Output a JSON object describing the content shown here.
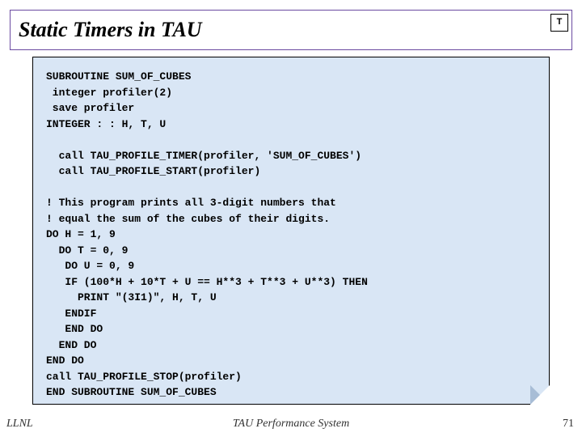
{
  "title": "Static Timers in TAU",
  "logo": "T",
  "code_lines": [
    "SUBROUTINE SUM_OF_CUBES",
    " integer profiler(2)",
    " save profiler",
    "INTEGER : : H, T, U",
    "",
    "  call TAU_PROFILE_TIMER(profiler, 'SUM_OF_CUBES')",
    "  call TAU_PROFILE_START(profiler)",
    "",
    "! This program prints all 3-digit numbers that",
    "! equal the sum of the cubes of their digits.",
    "DO H = 1, 9",
    "  DO T = 0, 9",
    "   DO U = 0, 9",
    "   IF (100*H + 10*T + U == H**3 + T**3 + U**3) THEN",
    "     PRINT \"(3I1)\", H, T, U",
    "   ENDIF",
    "   END DO",
    "  END DO",
    "END DO",
    "call TAU_PROFILE_STOP(profiler)",
    "END SUBROUTINE SUM_OF_CUBES"
  ],
  "footer": {
    "left": "LLNL",
    "center": "TAU Performance System",
    "right": "71"
  }
}
